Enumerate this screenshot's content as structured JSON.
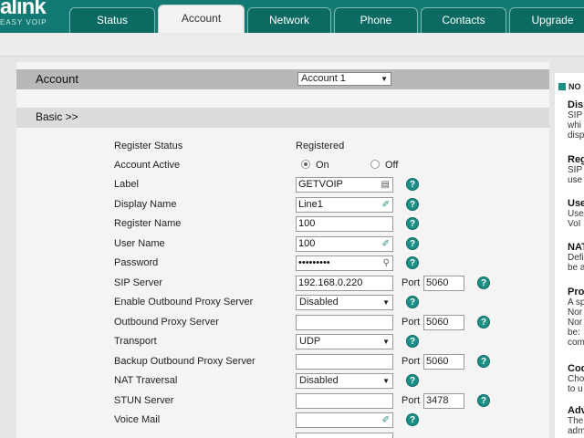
{
  "header": {
    "logo": "alink",
    "tagline": "EASY VOIP",
    "tabs": [
      "Status",
      "Account",
      "Network",
      "Phone",
      "Contacts",
      "Upgrade"
    ],
    "active_tab": "Account"
  },
  "account_section": {
    "title": "Account",
    "selected_account": "Account 1"
  },
  "basic_section": {
    "title": "Basic >>"
  },
  "form": {
    "register_status": {
      "label": "Register Status",
      "value": "Registered"
    },
    "account_active": {
      "label": "Account Active",
      "option_on": "On",
      "option_off": "Off",
      "selected": "On"
    },
    "label_field": {
      "label": "Label",
      "value": "GETVOIP"
    },
    "display_name": {
      "label": "Display Name",
      "value": "Line1"
    },
    "register_name": {
      "label": "Register Name",
      "value": "100"
    },
    "user_name": {
      "label": "User Name",
      "value": "100"
    },
    "password": {
      "label": "Password",
      "value": "•••••••••"
    },
    "sip_server": {
      "label": "SIP Server",
      "value": "192.168.0.220",
      "port_label": "Port",
      "port": "5060"
    },
    "outbound_proxy_enable": {
      "label": "Enable Outbound Proxy Server",
      "value": "Disabled"
    },
    "outbound_proxy_server": {
      "label": "Outbound Proxy Server",
      "value": "",
      "port_label": "Port",
      "port": "5060"
    },
    "transport": {
      "label": "Transport",
      "value": "UDP"
    },
    "backup_outbound_proxy": {
      "label": "Backup Outbound Proxy Server",
      "value": "",
      "port_label": "Port",
      "port": "5060"
    },
    "nat_traversal": {
      "label": "NAT Traversal",
      "value": "Disabled"
    },
    "stun_server": {
      "label": "STUN Server",
      "value": "",
      "port_label": "Port",
      "port": "3478"
    },
    "voice_mail": {
      "label": "Voice Mail",
      "value": ""
    }
  },
  "help_icon": "?",
  "notes": {
    "heading": "NO",
    "blocks": [
      {
        "title": "Disp",
        "lines": [
          "SIP",
          "whi",
          "disp"
        ]
      },
      {
        "title": "Reg",
        "lines": [
          "SIP",
          "use"
        ]
      },
      {
        "title": "Use",
        "lines": [
          "Use",
          "VoI"
        ]
      },
      {
        "title": "NAT",
        "lines": [
          "Defi",
          "be a"
        ]
      },
      {
        "title": "Pro",
        "lines": [
          "A sp",
          "Nor",
          "Nor",
          "be:",
          "com"
        ]
      },
      {
        "title": "Cod",
        "lines": [
          "Cho",
          "to u"
        ]
      },
      {
        "title": "Adv",
        "lines": [
          "The",
          "adm"
        ]
      }
    ]
  },
  "colors": {
    "header": "#137a73",
    "tab": "#0b6b63",
    "help": "#1c8f86",
    "section_header": "#b8b8b8"
  }
}
